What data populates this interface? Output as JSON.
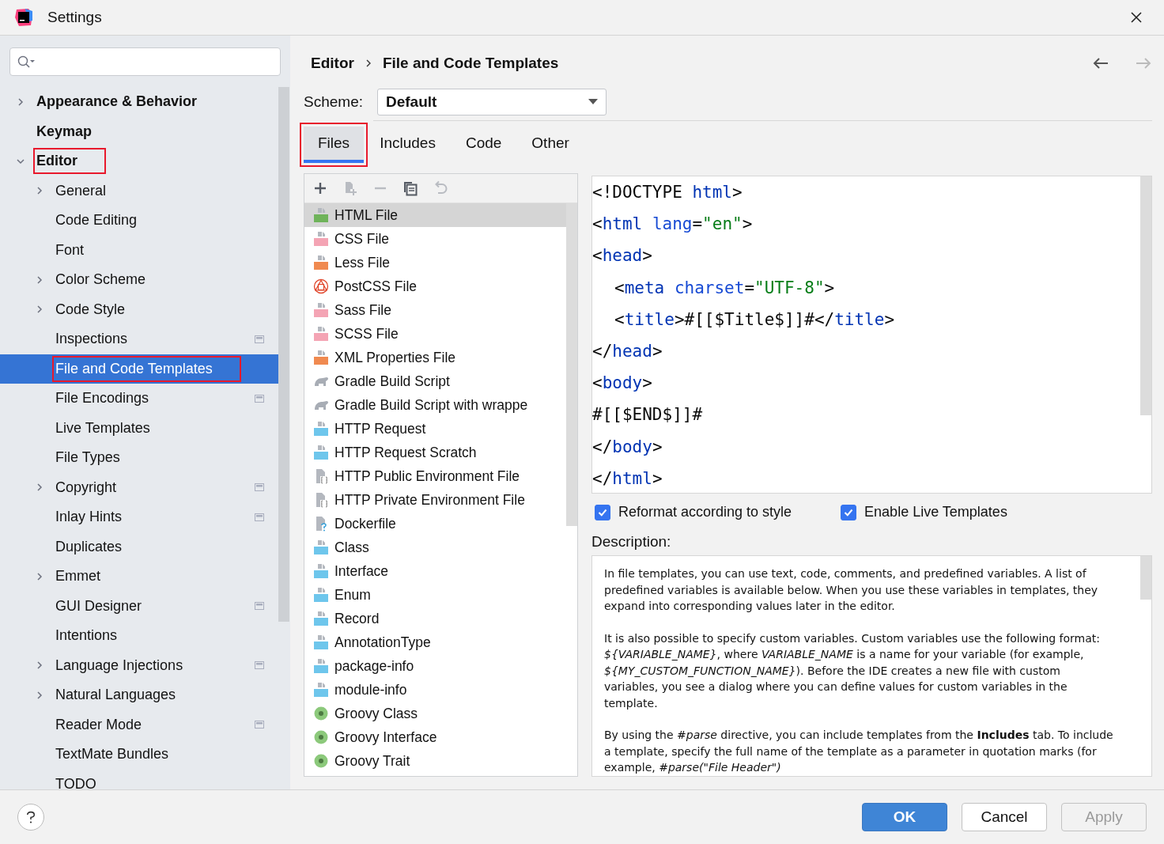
{
  "window": {
    "title": "Settings"
  },
  "sidebar": {
    "items": [
      {
        "label": "Appearance & Behavior",
        "expanded": false,
        "selected": false,
        "annotated": false,
        "project_scope": false
      },
      {
        "label": "Keymap",
        "selected": false,
        "annotated": false,
        "project_scope": false
      },
      {
        "label": "Editor",
        "expanded": true,
        "selected": false,
        "annotated": true,
        "project_scope": false,
        "children": [
          {
            "label": "General",
            "expanded": false,
            "selected": false,
            "annotated": false,
            "project_scope": false
          },
          {
            "label": "Code Editing",
            "selected": false,
            "annotated": false,
            "project_scope": false
          },
          {
            "label": "Font",
            "selected": false,
            "annotated": false,
            "project_scope": false
          },
          {
            "label": "Color Scheme",
            "expanded": false,
            "selected": false,
            "annotated": false,
            "project_scope": false
          },
          {
            "label": "Code Style",
            "expanded": false,
            "selected": false,
            "annotated": false,
            "project_scope": false
          },
          {
            "label": "Inspections",
            "selected": false,
            "annotated": false,
            "project_scope": true
          },
          {
            "label": "File and Code Templates",
            "selected": true,
            "annotated": true,
            "project_scope": false
          },
          {
            "label": "File Encodings",
            "selected": false,
            "annotated": false,
            "project_scope": true
          },
          {
            "label": "Live Templates",
            "selected": false,
            "annotated": false,
            "project_scope": false
          },
          {
            "label": "File Types",
            "selected": false,
            "annotated": false,
            "project_scope": false
          },
          {
            "label": "Copyright",
            "expanded": false,
            "selected": false,
            "annotated": false,
            "project_scope": true
          },
          {
            "label": "Inlay Hints",
            "selected": false,
            "annotated": false,
            "project_scope": true
          },
          {
            "label": "Duplicates",
            "selected": false,
            "annotated": false,
            "project_scope": false
          },
          {
            "label": "Emmet",
            "expanded": false,
            "selected": false,
            "annotated": false,
            "project_scope": false
          },
          {
            "label": "GUI Designer",
            "selected": false,
            "annotated": false,
            "project_scope": true
          },
          {
            "label": "Intentions",
            "selected": false,
            "annotated": false,
            "project_scope": false
          },
          {
            "label": "Language Injections",
            "expanded": false,
            "selected": false,
            "annotated": false,
            "project_scope": true
          },
          {
            "label": "Natural Languages",
            "expanded": false,
            "selected": false,
            "annotated": false,
            "project_scope": false
          },
          {
            "label": "Reader Mode",
            "selected": false,
            "annotated": false,
            "project_scope": true
          },
          {
            "label": "TextMate Bundles",
            "selected": false,
            "annotated": false,
            "project_scope": false
          },
          {
            "label": "TODO",
            "selected": false,
            "annotated": false,
            "project_scope": false
          }
        ]
      }
    ]
  },
  "breadcrumb": {
    "items": [
      "Editor",
      "File and Code Templates"
    ],
    "back_disabled": false,
    "forward_disabled": true
  },
  "scheme": {
    "label": "Scheme:",
    "value": "Default"
  },
  "tabs": [
    {
      "label": "Files",
      "selected": true,
      "annotated": true
    },
    {
      "label": "Includes",
      "selected": false,
      "annotated": false
    },
    {
      "label": "Code",
      "selected": false,
      "annotated": false
    },
    {
      "label": "Other",
      "selected": false,
      "annotated": false
    }
  ],
  "toolbar": [
    {
      "kind": "add",
      "disabled": false
    },
    {
      "kind": "add-child",
      "disabled": true
    },
    {
      "kind": "remove",
      "disabled": true
    },
    {
      "kind": "copy",
      "disabled": false
    },
    {
      "kind": "reset",
      "disabled": true
    }
  ],
  "templates": [
    {
      "name": "HTML File",
      "kind": "html",
      "selected": true
    },
    {
      "name": "CSS File",
      "kind": "css",
      "selected": false
    },
    {
      "name": "Less File",
      "kind": "less",
      "selected": false
    },
    {
      "name": "PostCSS File",
      "kind": "postcss",
      "selected": false
    },
    {
      "name": "Sass File",
      "kind": "sass",
      "selected": false
    },
    {
      "name": "SCSS File",
      "kind": "sass",
      "selected": false
    },
    {
      "name": "XML Properties File",
      "kind": "xml",
      "selected": false
    },
    {
      "name": "Gradle Build Script",
      "kind": "gradle",
      "selected": false
    },
    {
      "name": "Gradle Build Script with wrappe",
      "kind": "gradle",
      "selected": false
    },
    {
      "name": "HTTP Request",
      "kind": "api",
      "selected": false
    },
    {
      "name": "HTTP Request Scratch",
      "kind": "api",
      "selected": false
    },
    {
      "name": "HTTP Public Environment File",
      "kind": "env",
      "selected": false
    },
    {
      "name": "HTTP Private Environment File",
      "kind": "env",
      "selected": false
    },
    {
      "name": "Dockerfile",
      "kind": "unknown",
      "selected": false
    },
    {
      "name": "Class",
      "kind": "java",
      "selected": false
    },
    {
      "name": "Interface",
      "kind": "java",
      "selected": false
    },
    {
      "name": "Enum",
      "kind": "java",
      "selected": false
    },
    {
      "name": "Record",
      "kind": "java",
      "selected": false
    },
    {
      "name": "AnnotationType",
      "kind": "java",
      "selected": false
    },
    {
      "name": "package-info",
      "kind": "java",
      "selected": false
    },
    {
      "name": "module-info",
      "kind": "java",
      "selected": false
    },
    {
      "name": "Groovy Class",
      "kind": "groovy",
      "selected": false
    },
    {
      "name": "Groovy Interface",
      "kind": "groovy",
      "selected": false
    },
    {
      "name": "Groovy Trait",
      "kind": "groovy",
      "selected": false
    }
  ],
  "code_lines": [
    {
      "indent": false,
      "tokens": [
        {
          "text": "<!DOCTYPE ",
          "kind": "plain"
        },
        {
          "text": "html",
          "kind": "tag"
        },
        {
          "text": ">",
          "kind": "plain"
        }
      ]
    },
    {
      "indent": false,
      "tokens": [
        {
          "text": "<",
          "kind": "plain"
        },
        {
          "text": "html",
          "kind": "tag"
        },
        {
          "text": " lang",
          "kind": "attr"
        },
        {
          "text": "=",
          "kind": "plain"
        },
        {
          "text": "\"en\"",
          "kind": "value"
        },
        {
          "text": ">",
          "kind": "plain"
        }
      ]
    },
    {
      "indent": false,
      "tokens": [
        {
          "text": "<",
          "kind": "plain"
        },
        {
          "text": "head",
          "kind": "tag"
        },
        {
          "text": ">",
          "kind": "plain"
        }
      ]
    },
    {
      "indent": true,
      "tokens": [
        {
          "text": "<",
          "kind": "plain"
        },
        {
          "text": "meta",
          "kind": "tag"
        },
        {
          "text": " charset",
          "kind": "attr"
        },
        {
          "text": "=",
          "kind": "plain"
        },
        {
          "text": "\"UTF-8\"",
          "kind": "value"
        },
        {
          "text": ">",
          "kind": "plain"
        }
      ]
    },
    {
      "indent": true,
      "tokens": [
        {
          "text": "<",
          "kind": "plain"
        },
        {
          "text": "title",
          "kind": "tag"
        },
        {
          "text": ">#[[$Title$]]#</",
          "kind": "plain"
        },
        {
          "text": "title",
          "kind": "tag"
        },
        {
          "text": ">",
          "kind": "plain"
        }
      ]
    },
    {
      "indent": false,
      "tokens": [
        {
          "text": "</",
          "kind": "plain"
        },
        {
          "text": "head",
          "kind": "tag"
        },
        {
          "text": ">",
          "kind": "plain"
        }
      ]
    },
    {
      "indent": false,
      "tokens": [
        {
          "text": "<",
          "kind": "plain"
        },
        {
          "text": "body",
          "kind": "tag"
        },
        {
          "text": ">",
          "kind": "plain"
        }
      ]
    },
    {
      "indent": false,
      "tokens": [
        {
          "text": "#[[$END$]]#",
          "kind": "plain"
        }
      ]
    },
    {
      "indent": false,
      "tokens": [
        {
          "text": "</",
          "kind": "plain"
        },
        {
          "text": "body",
          "kind": "tag"
        },
        {
          "text": ">",
          "kind": "plain"
        }
      ]
    },
    {
      "indent": false,
      "tokens": [
        {
          "text": "</",
          "kind": "plain"
        },
        {
          "text": "html",
          "kind": "tag"
        },
        {
          "text": ">",
          "kind": "plain"
        }
      ]
    }
  ],
  "options": [
    {
      "label": "Reformat according to style",
      "checked": true
    },
    {
      "label": "Enable Live Templates",
      "checked": true
    }
  ],
  "description": {
    "label": "Description:",
    "paragraphs": [
      "In file templates, you can use text, code, comments, and predefined variables. A list of predefined variables is available below. When you use these variables in templates, they expand into corresponding values later in the editor.",
      "It is also possible to specify custom variables. Custom variables use the following format: *${VARIABLE_NAME}*, where *VARIABLE_NAME* is a name for your variable (for example, *${MY_CUSTOM_FUNCTION_NAME}*). Before the IDE creates a new file with custom variables, you see a dialog where you can define values for custom variables in the template.",
      "By using the *#parse* directive, you can include templates from the **Includes** tab. To include a template, specify the full name of the template as a parameter in quotation marks (for example, *#parse(\"File Header\")*"
    ]
  },
  "buttons": [
    {
      "label": "OK",
      "kind": "primary",
      "disabled": false
    },
    {
      "label": "Cancel",
      "kind": "normal",
      "disabled": false
    },
    {
      "label": "Apply",
      "kind": "normal",
      "disabled": true
    }
  ]
}
